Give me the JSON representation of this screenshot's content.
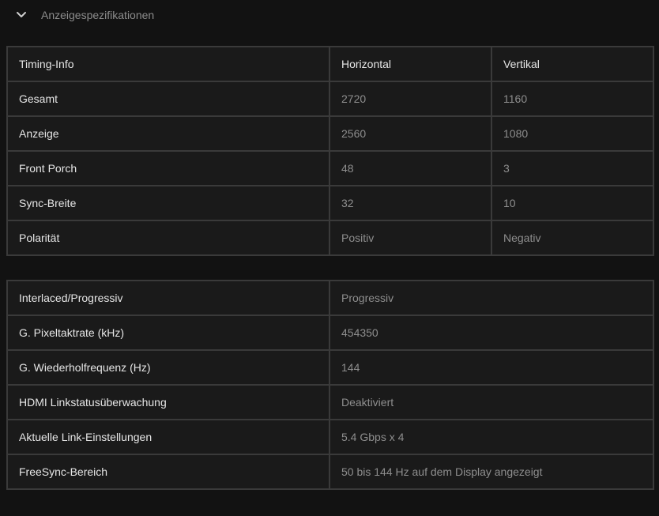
{
  "section": {
    "title": "Anzeigespezifikationen",
    "icon": "chevron-down-icon"
  },
  "timing": {
    "headers": [
      "Timing-Info",
      "Horizontal",
      "Vertikal"
    ],
    "rows": [
      {
        "label": "Gesamt",
        "horizontal": "2720",
        "vertical": "1160"
      },
      {
        "label": "Anzeige",
        "horizontal": "2560",
        "vertical": "1080"
      },
      {
        "label": "Front Porch",
        "horizontal": "48",
        "vertical": "3"
      },
      {
        "label": "Sync-Breite",
        "horizontal": "32",
        "vertical": "10"
      },
      {
        "label": "Polarität",
        "horizontal": "Positiv",
        "vertical": "Negativ"
      }
    ]
  },
  "link": {
    "rows": [
      {
        "label": "Interlaced/Progressiv",
        "value": "Progressiv"
      },
      {
        "label": "G. Pixeltaktrate (kHz)",
        "value": "454350"
      },
      {
        "label": "G. Wiederholfrequenz (Hz)",
        "value": "144"
      },
      {
        "label": "HDMI Linkstatusüberwachung",
        "value": "Deaktiviert"
      },
      {
        "label": "Aktuelle Link-Einstellungen",
        "value": "5.4 Gbps x 4"
      },
      {
        "label": "FreeSync-Bereich",
        "value": "50 bis 144 Hz auf dem Display angezeigt"
      }
    ]
  },
  "colors": {
    "background": "#121212",
    "cell_background": "#1a1a1a",
    "border": "#3a3a3a",
    "label_text": "#e6e6e6",
    "value_text": "#8e8e8e"
  }
}
